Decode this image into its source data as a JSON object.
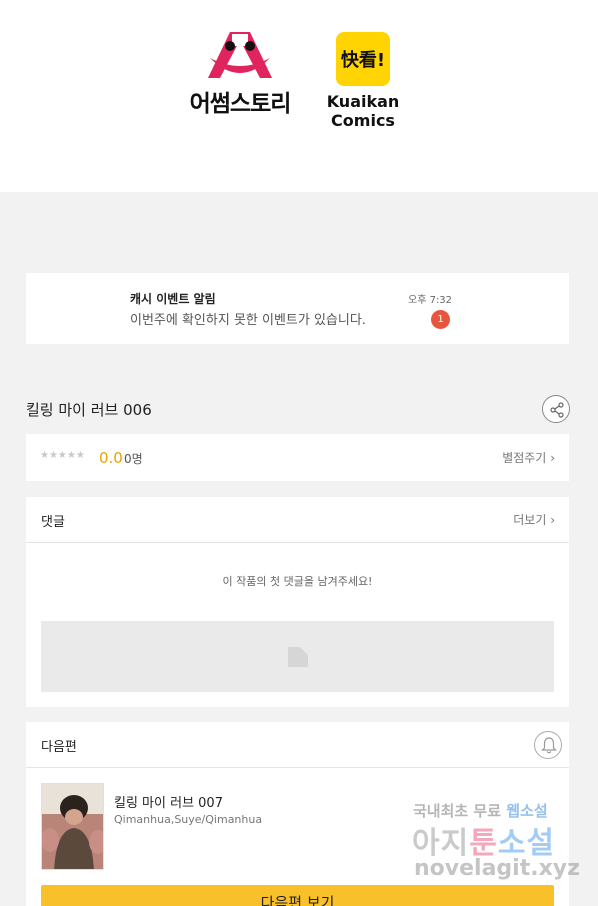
{
  "header": {
    "logo_left_text": "어썸스토리",
    "logo_right_badge": "快看!",
    "logo_right_text": "Kuaikan Comics"
  },
  "notice": {
    "title": "캐시 이벤트 알림",
    "message": "이번주에 확인하지 못한 이벤트가 있습니다.",
    "time": "오후 7:32",
    "badge_count": "1",
    "badge_color": "#e8553d"
  },
  "episode": {
    "title": "킬링 마이 러브 006"
  },
  "rating": {
    "stars": "★★★★★",
    "score": "0.0",
    "count": "0명",
    "rate_link": "별점주기",
    "score_color": "#e6a400"
  },
  "comments": {
    "title": "댓글",
    "more_link": "더보기",
    "empty_text": "이 작품의 첫 댓글을 남겨주세요!"
  },
  "next_episode": {
    "section_title": "다음편",
    "title": "킬링 마이 러브 007",
    "authors": "Qimanhua,Suye/Qimanhua",
    "button_label": "다음편 보기",
    "button_color": "#f8c12b"
  },
  "watermark": {
    "line1_a": "국내최초 무료",
    "line1_b": "웹소설",
    "line2_a": "아지",
    "line2_b": "툰",
    "line2_c": "소설",
    "line3": "novelagit.xyz"
  }
}
